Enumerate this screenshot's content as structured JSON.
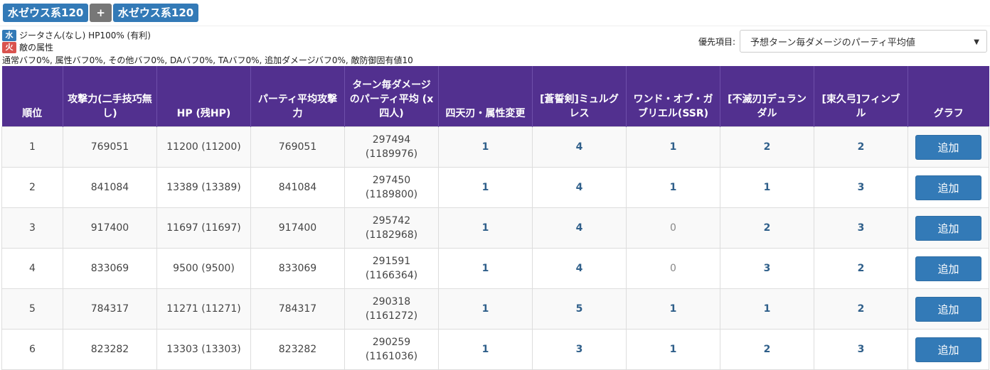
{
  "header": {
    "summon_left": "水ゼウス系120",
    "plus": "+",
    "summon_right": "水ゼウス系120"
  },
  "info": {
    "player_badge": "水",
    "player_text": "ジータさん(なし) HP100% (有利)",
    "enemy_badge": "火",
    "enemy_text": "敵の属性",
    "buff_text": "通常バフ0%, 属性バフ0%, その他バフ0%, DAバフ0%, TAバフ0%, 追加ダメージバフ0%, 敵防御固有値10"
  },
  "priority": {
    "label": "優先項目:",
    "selected": "予想ターン毎ダメージのパーティ平均値"
  },
  "table": {
    "headers": {
      "rank": "順位",
      "attack": "攻撃力(二手技巧無し)",
      "hp": "HP (残HP)",
      "party_attack": "パーティ平均攻撃力",
      "turn_damage": "ターン毎ダメージのパーティ平均 (x四人)",
      "w1": "四天刃・属性変更",
      "w2": "[蒼誓剣]ミュルグレス",
      "w3": "ワンド・オブ・ガブリエル(SSR)",
      "w4": "[不滅刃]デュランダル",
      "w5": "[束久弓]フィンブル",
      "graph": "グラフ"
    },
    "add_label": "追加",
    "rows": [
      {
        "rank": "1",
        "attack": "769051",
        "hp": "11200 (11200)",
        "party_attack": "769051",
        "dmg": "297494",
        "dmg4": "(1189976)",
        "w1": "1",
        "w2": "4",
        "w3": "1",
        "w4": "2",
        "w5": "2"
      },
      {
        "rank": "2",
        "attack": "841084",
        "hp": "13389 (13389)",
        "party_attack": "841084",
        "dmg": "297450",
        "dmg4": "(1189800)",
        "w1": "1",
        "w2": "4",
        "w3": "1",
        "w4": "1",
        "w5": "3"
      },
      {
        "rank": "3",
        "attack": "917400",
        "hp": "11697 (11697)",
        "party_attack": "917400",
        "dmg": "295742",
        "dmg4": "(1182968)",
        "w1": "1",
        "w2": "4",
        "w3": "0",
        "w4": "2",
        "w5": "3"
      },
      {
        "rank": "4",
        "attack": "833069",
        "hp": "9500 (9500)",
        "party_attack": "833069",
        "dmg": "291591",
        "dmg4": "(1166364)",
        "w1": "1",
        "w2": "4",
        "w3": "0",
        "w4": "3",
        "w5": "2"
      },
      {
        "rank": "5",
        "attack": "784317",
        "hp": "11271 (11271)",
        "party_attack": "784317",
        "dmg": "290318",
        "dmg4": "(1161272)",
        "w1": "1",
        "w2": "5",
        "w3": "1",
        "w4": "1",
        "w5": "2"
      },
      {
        "rank": "6",
        "attack": "823282",
        "hp": "13303 (13303)",
        "party_attack": "823282",
        "dmg": "290259",
        "dmg4": "(1161036)",
        "w1": "1",
        "w2": "3",
        "w3": "1",
        "w4": "2",
        "w5": "3"
      }
    ]
  }
}
